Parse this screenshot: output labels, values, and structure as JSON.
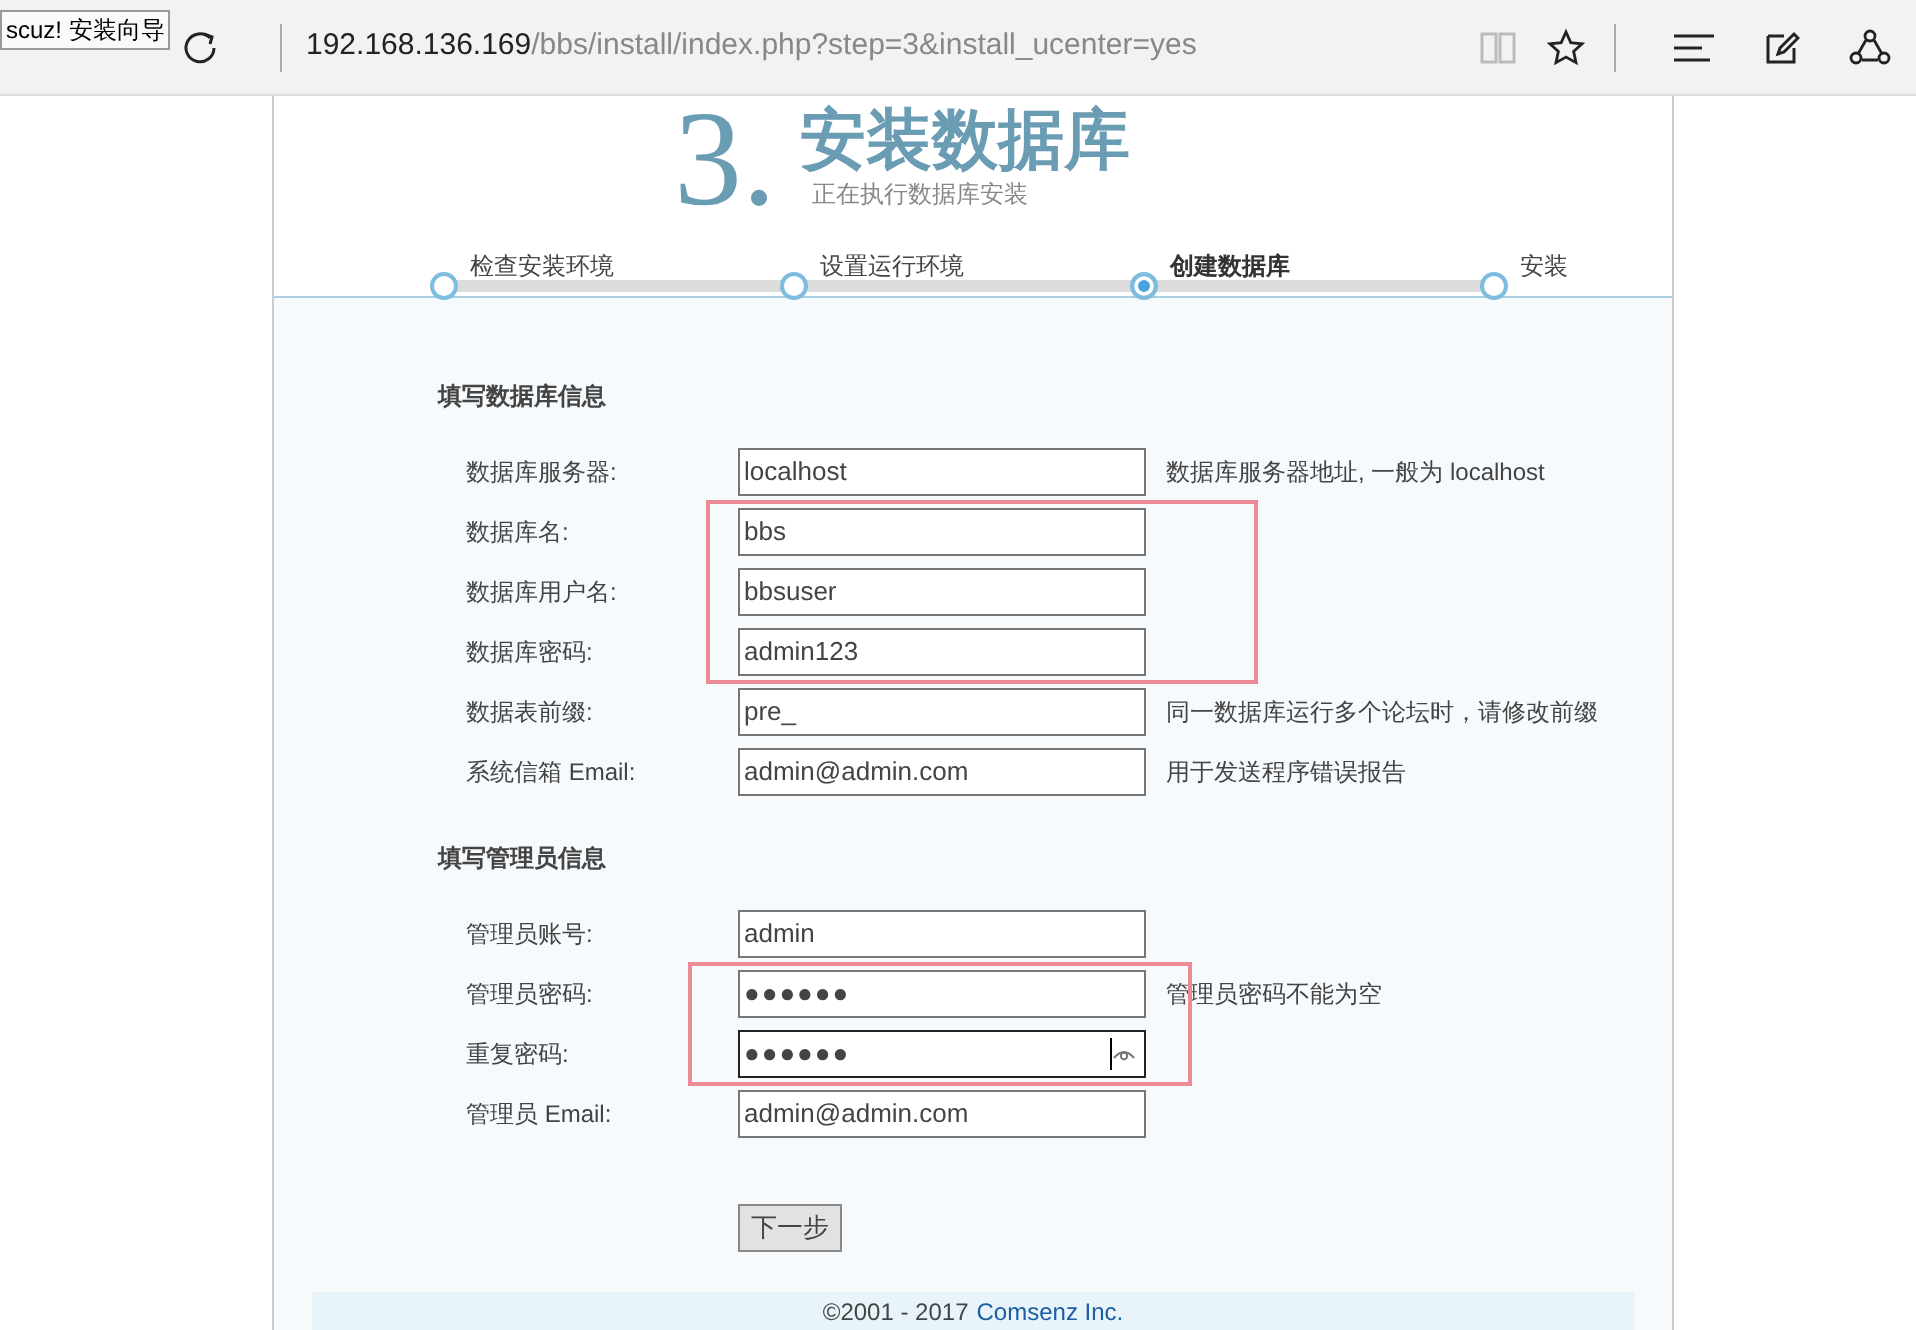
{
  "browser": {
    "tooltip": "scuz! 安装向导",
    "address_host": "192.168.136.169",
    "address_path": "/bbs/install/index.php?step=3&install_ucenter=yes"
  },
  "header": {
    "step_number": "3.",
    "title": "安装数据库",
    "subtitle": "正在执行数据库安装"
  },
  "steps": [
    {
      "label": "检查安装环境",
      "selected": false
    },
    {
      "label": "设置运行环境",
      "selected": false
    },
    {
      "label": "创建数据库",
      "selected": true
    },
    {
      "label": "安装",
      "selected": false
    }
  ],
  "sections": [
    {
      "heading": "填写数据库信息",
      "fields": [
        {
          "label": "数据库服务器:",
          "kind": "text",
          "value": "localhost",
          "hint": "数据库服务器地址, 一般为 localhost",
          "focused": false
        },
        {
          "label": "数据库名:",
          "kind": "text",
          "value": "bbs",
          "highlighted": true,
          "focused": false
        },
        {
          "label": "数据库用户名:",
          "kind": "text",
          "value": "bbsuser",
          "highlighted": true,
          "focused": false
        },
        {
          "label": "数据库密码:",
          "kind": "text",
          "value": "admin123",
          "highlighted": true,
          "focused": false
        },
        {
          "label": "数据表前缀:",
          "kind": "text",
          "value": "pre_",
          "hint": "同一数据库运行多个论坛时，请修改前缀",
          "focused": false
        },
        {
          "label": "系统信箱 Email:",
          "kind": "text",
          "value": "admin@admin.com",
          "hint": "用于发送程序错误报告",
          "focused": false
        }
      ]
    },
    {
      "heading": "填写管理员信息",
      "fields": [
        {
          "label": "管理员账号:",
          "kind": "text",
          "value": "admin",
          "focused": false
        },
        {
          "label": "管理员密码:",
          "kind": "password",
          "value": "●●●●●●",
          "hint": "管理员密码不能为空",
          "highlighted": true,
          "focused": false
        },
        {
          "label": "重复密码:",
          "kind": "password",
          "value": "●●●●●●",
          "highlighted": true,
          "focused": true
        },
        {
          "label": "管理员 Email:",
          "kind": "text",
          "value": "admin@admin.com",
          "focused": false
        }
      ]
    }
  ],
  "next_button": "下一步",
  "footer": {
    "copyright": "©2001 - 2017",
    "company_link": "Comsenz Inc."
  }
}
